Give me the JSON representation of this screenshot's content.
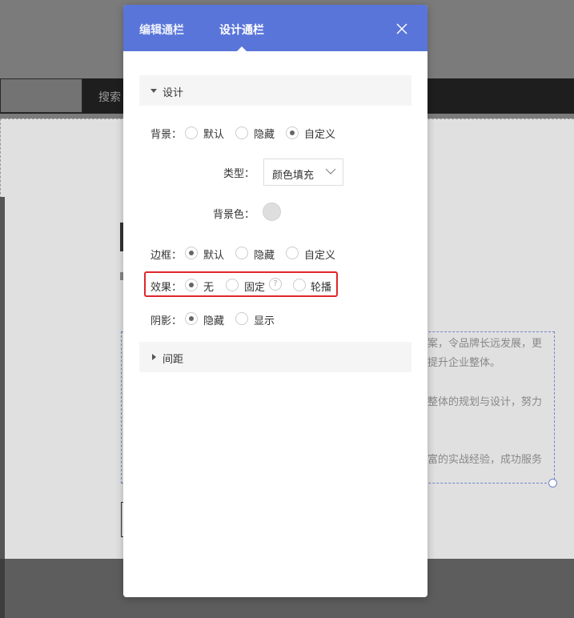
{
  "background": {
    "search_button": "搜索",
    "text_lines": [
      "案，令品牌长远发展，更",
      "提升企业整体。",
      "整体的规划与设计，努力",
      "富的实战经验，成功服务"
    ]
  },
  "dialog": {
    "tabs": [
      {
        "label": "编辑通栏",
        "active": false
      },
      {
        "label": "设计通栏",
        "active": true
      }
    ],
    "design_section": {
      "label": "设计",
      "expanded": true
    },
    "spacing_section": {
      "label": "间距",
      "expanded": false
    },
    "background": {
      "label": "背景：",
      "options": [
        "默认",
        "隐藏",
        "自定义"
      ],
      "selected": "自定义"
    },
    "type": {
      "label": "类型：",
      "value": "颜色填充"
    },
    "bg_color": {
      "label": "背景色：",
      "value": "#dedede"
    },
    "border": {
      "label": "边框：",
      "options": [
        "默认",
        "隐藏",
        "自定义"
      ],
      "selected": "默认"
    },
    "effect": {
      "label": "效果：",
      "options": [
        "无",
        "固定",
        "轮播"
      ],
      "selected": "无",
      "help": "?"
    },
    "shadow": {
      "label": "阴影：",
      "options": [
        "隐藏",
        "显示"
      ],
      "selected": "隐藏"
    }
  },
  "colors": {
    "header": "#5975d9",
    "highlight": "#e0262c"
  }
}
